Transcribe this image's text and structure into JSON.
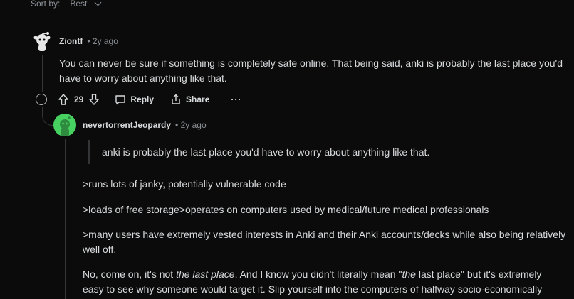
{
  "sort": {
    "label": "Sort by:",
    "value": "Best"
  },
  "comment1": {
    "username": "Ziontf",
    "time": "• 2y ago",
    "body_line1": "You can never be sure if something is completely safe online. That being said, anki is probably the last place you'd",
    "body_line2": "have to worry about anything like that.",
    "votes": "29",
    "reply_label": "Reply",
    "share_label": "Share",
    "more_label": "···"
  },
  "comment2": {
    "username": "nevertorrentJeopardy",
    "time": "• 2y ago",
    "quote": "anki is probably the last place you'd have to worry about anything like that.",
    "p1": ">runs lots of janky, potentially vulnerable code",
    "p2": ">loads of free storage>operates on computers used by medical/future medical professionals",
    "p3_line1": ">many users have extremely vested interests in Anki and their Anki accounts/decks while also being relatively",
    "p3_line2": "well off.",
    "p4_a": "No, come on, it's not ",
    "p4_em1": "the last place",
    "p4_b": ". And I know you didn't literally mean \"",
    "p4_em2": "the",
    "p4_c": " last place\" but it's extremely",
    "p4_line2": "easy to see why someone would target it. Slip yourself into the computers of halfway socio-economically"
  },
  "colors": {
    "background": "#0b0b0b",
    "text": "#d7dadc",
    "muted": "#8b9196",
    "avatar_green": "#46d160"
  }
}
